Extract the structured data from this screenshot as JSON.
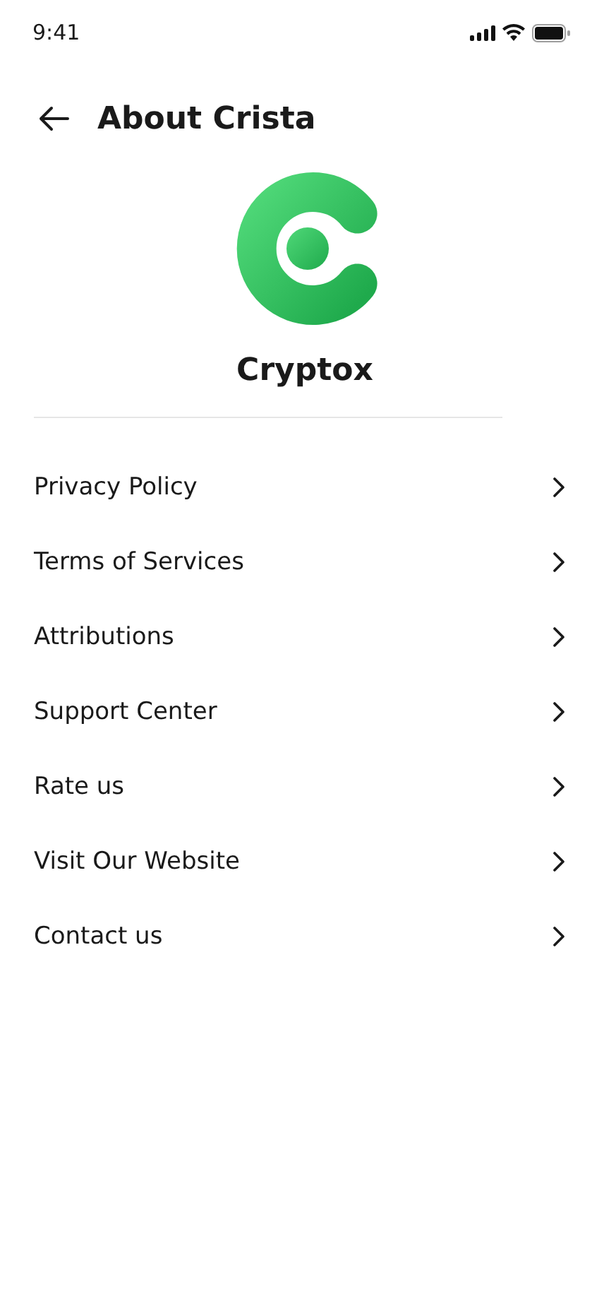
{
  "status_bar": {
    "time": "9:41"
  },
  "header": {
    "title": "About Crista"
  },
  "app": {
    "name": "Cryptox"
  },
  "menu": [
    {
      "label": "Privacy Policy"
    },
    {
      "label": "Terms of Services"
    },
    {
      "label": "Attributions"
    },
    {
      "label": "Support Center"
    },
    {
      "label": "Rate us"
    },
    {
      "label": "Visit Our Website"
    },
    {
      "label": "Contact us"
    }
  ]
}
